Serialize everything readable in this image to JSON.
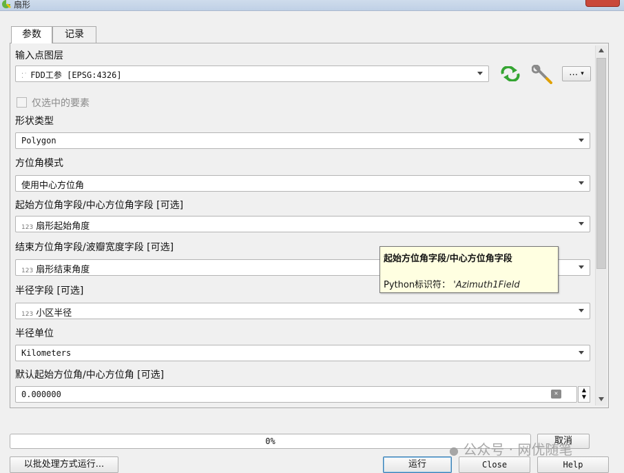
{
  "window": {
    "title": "扇形"
  },
  "tabs": [
    {
      "label": "参数",
      "active": true
    },
    {
      "label": "记录",
      "active": false
    }
  ],
  "params": {
    "input_layer": {
      "label": "输入点图层",
      "value": "FDD工参 [EPSG:4326]"
    },
    "selected_only": {
      "label": "仅选中的要素",
      "checked": false
    },
    "shape_type": {
      "label": "形状类型",
      "value": "Polygon"
    },
    "azimuth_mode": {
      "label": "方位角模式",
      "value": "使用中心方位角"
    },
    "start_azimuth_field": {
      "label": "起始方位角字段/中心方位角字段 [可选]",
      "value": "扇形起始角度",
      "type_badge": "123"
    },
    "end_azimuth_field": {
      "label": "结束方位角字段/波瓣宽度字段 [可选]",
      "value": "扇形结束角度",
      "type_badge": "123"
    },
    "radius_field": {
      "label": "半径字段 [可选]",
      "value": "小区半径",
      "type_badge": "123"
    },
    "radius_unit": {
      "label": "半径单位",
      "value": "Kilometers"
    },
    "default_start_azimuth": {
      "label": "默认起始方位角/中心方位角 [可选]",
      "value": "0.000000"
    }
  },
  "tooltip": {
    "title": "起始方位角字段/中心方位角字段",
    "id_label": "Python标识符：",
    "id_value": "'Azimuth1Field"
  },
  "toolbar": {
    "more_label": "…"
  },
  "progress": {
    "text": "0%",
    "value": 0
  },
  "buttons": {
    "batch": "以批处理方式运行...",
    "run": "运行",
    "close": "Close",
    "help": "Help",
    "cancel": "取消"
  },
  "watermark": "公众号 · 网优随笔",
  "colors": {
    "tooltip_bg": "#ffffe1",
    "accent_green": "#35a532",
    "title_close": "#c9483a"
  }
}
